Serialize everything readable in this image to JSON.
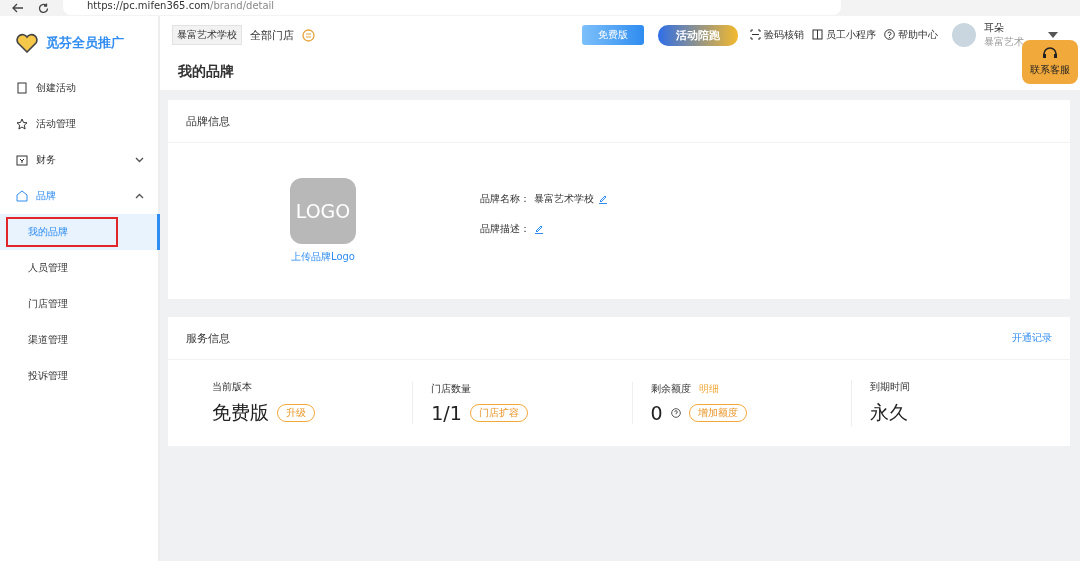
{
  "browser": {
    "url_host": "https://pc.mifen365.com",
    "url_path": "/brand/detail"
  },
  "brand": {
    "name": "觅芬全员推广"
  },
  "header": {
    "school": "暴富艺术学校",
    "store": "全部门店",
    "version_badge": "免费版",
    "promo_badge": "活动陪跑",
    "links": [
      {
        "label": "验码核销"
      },
      {
        "label": "员工小程序"
      },
      {
        "label": "帮助中心"
      }
    ],
    "user": {
      "name": "耳朵",
      "org": "暴富艺术"
    }
  },
  "service_float": {
    "label": "联系客服"
  },
  "sidebar": {
    "items": [
      {
        "label": "创建活动",
        "kind": "item"
      },
      {
        "label": "活动管理",
        "kind": "item"
      },
      {
        "label": "财务",
        "expanded": false,
        "kind": "group"
      },
      {
        "label": "品牌",
        "expanded": true,
        "kind": "group",
        "children": [
          {
            "label": "我的品牌",
            "selected": true,
            "annotated": true
          },
          {
            "label": "人员管理",
            "selected": false,
            "annotated": false
          },
          {
            "label": "门店管理",
            "selected": false,
            "annotated": false
          },
          {
            "label": "渠道管理",
            "selected": false,
            "annotated": false
          },
          {
            "label": "投诉管理",
            "selected": false,
            "annotated": false
          }
        ]
      }
    ]
  },
  "page_title": "我的品牌",
  "brand_card": {
    "title": "品牌信息",
    "logo_text": "LOGO",
    "upload_link": "上传品牌Logo",
    "fields": [
      {
        "label": "品牌名称：",
        "value": "暴富艺术学校"
      },
      {
        "label": "品牌描述："
      }
    ]
  },
  "service_card": {
    "title": "服务信息",
    "link": "开通记录",
    "stats": [
      {
        "label": "当前版本",
        "value": "免费版",
        "help": false,
        "action": "升级"
      },
      {
        "label": "门店数量",
        "value": "1/1",
        "help": false,
        "action": "门店扩容"
      },
      {
        "label": "剩余额度",
        "label_link": "明细",
        "value": "0",
        "help": true,
        "action": "增加额度"
      },
      {
        "label": "到期时间",
        "value": "永久",
        "help": false
      }
    ]
  }
}
